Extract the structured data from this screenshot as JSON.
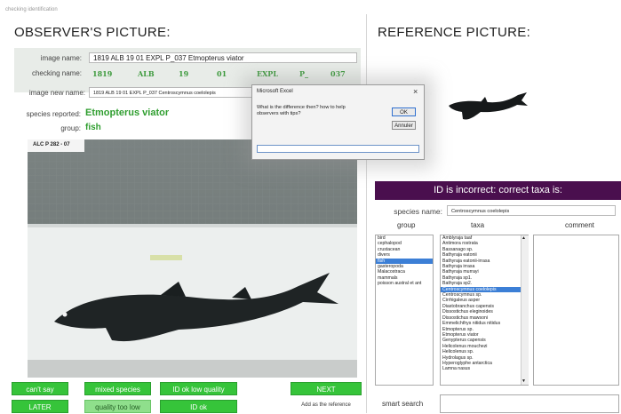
{
  "window_title": "checking identification",
  "observer": {
    "heading": "OBSERVER'S PICTURE:",
    "image_name_label": "image name:",
    "image_name_value": "1819 ALB 19 01 EXPL P_037 Etmopterus viator",
    "checking_name_label": "checking name:",
    "checking_parts": [
      "1819",
      "ALB",
      "19",
      "01",
      "EXPL",
      "P_",
      "037"
    ],
    "image_new_name_label": "image new name:",
    "image_new_name_value": "1819 ALB 19 01 EXPL P_037 Centroscymnus coelolepis",
    "species_reported_label": "species reported:",
    "species_reported_value": "Etmopterus viator",
    "group_label": "group:",
    "group_value": "fish",
    "photo_tag": "ALC P 282 - 07"
  },
  "buttons": {
    "cant_say": "can't say",
    "mixed_species": "mixed species",
    "id_ok_low_quality": "ID ok low quality",
    "next": "NEXT",
    "later": "LATER",
    "quality_too_low": "quality too low",
    "id_ok": "ID ok",
    "add_reference": "Add as the reference"
  },
  "dialog": {
    "title": "Microsoft Excel",
    "close": "×",
    "message": "What is the difference then? how to help observers with tips?",
    "ok": "OK",
    "cancel": "Annuler",
    "input_value": ""
  },
  "reference": {
    "heading": "REFERENCE PICTURE:",
    "banner": "ID is incorrect: correct taxa is:",
    "species_name_label": "species name:",
    "species_name_value": "Centroscymnus coelolepis",
    "col_group": "group",
    "col_taxa": "taxa",
    "col_comment": "comment",
    "groups": [
      "bird",
      "cephalopod",
      "crustacean",
      "divers",
      "fish",
      "gasteropoda",
      "Malacostraca",
      "mammals",
      "poisson austral et ant"
    ],
    "group_selected_index": 4,
    "taxa": [
      "Amblyraja taaf",
      "Antimora rostrata",
      "Bassanago sp.",
      "Bathyraja eatonii",
      "Bathyraja eatonii-irrasa",
      "Bathyraja irrasa",
      "Bathyraja murrayi",
      "Bathyraja sp1.",
      "Bathyraja sp2.",
      "Centroscymnus coelolepis",
      "Centroscymnus sp.",
      "Cirrhigaleus asper",
      "Diastobranchus capensis",
      "Dissostichus eleginoides",
      "Dissostichus mawsoni",
      "Emmelichthys nitidus nitidus",
      "Etmopterus sp.",
      "Etmopterus viator",
      "Genypterus capensis",
      "Helicolenus mouchezi",
      "Helicolenus sp.",
      "Hydrolagus sp.",
      "Hyperoglyphe antarctica",
      "Lamna nasus"
    ],
    "taxa_selected_index": 9,
    "smart_search_label": "smart search"
  }
}
